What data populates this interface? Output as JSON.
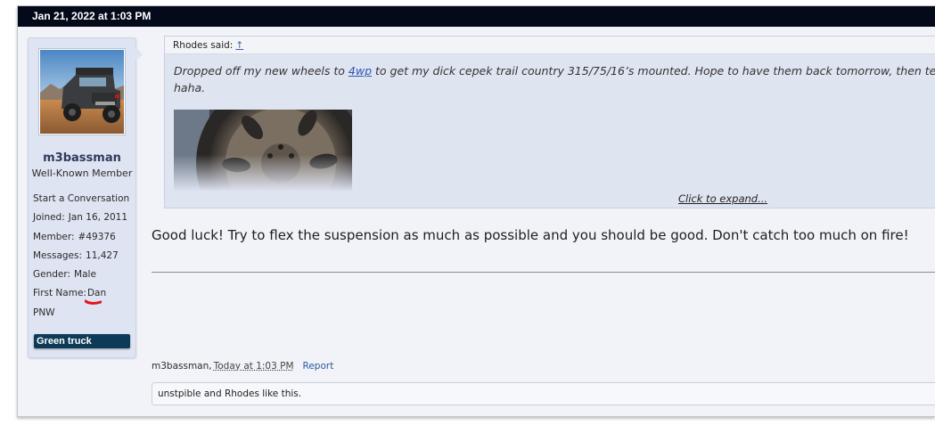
{
  "post": {
    "date": "Jan 21, 2022 at 1:03 PM"
  },
  "user": {
    "avatar": "truck-photo",
    "name": "m3bassman",
    "title": "Well-Known Member",
    "start_conversation": "Start a Conversation",
    "fields": [
      {
        "label": "Joined:",
        "value": "Jan 16, 2011"
      },
      {
        "label": "Member:",
        "value": "#49376"
      },
      {
        "label": "Messages:",
        "value": "11,427"
      },
      {
        "label": "Gender:",
        "value": "Male"
      },
      {
        "label": "First Name:",
        "value": "Dan"
      }
    ],
    "location": "PNW",
    "banner": "Green truck",
    "annotation_color": "#e0141c"
  },
  "quote": {
    "author": "Rhodes said:",
    "up_arrow": "↑",
    "text_before_link": "Dropped off my new wheels to ",
    "link": "4wp",
    "text_after_link": " to get my dick cepek trail country 315/75/16’s mounted. Hope to have them back tomorrow, then test fit",
    "text_line2": "haha.",
    "image": "wheel-photo",
    "expand": "Click to expand..."
  },
  "message": "Good luck! Try to flex the suspension as much as possible and you should be good. Don't catch too much on fire!",
  "footer": {
    "author": "m3bassman,",
    "time": "Today at 1:03 PM",
    "report": "Report"
  },
  "likes": "unstpible and Rhodes like this.",
  "colors": {
    "header_bg": "#040a1a",
    "userinfo_bg": "#dfe4f2",
    "banner_bg": "#0d3a57",
    "link": "#2c58b2"
  }
}
